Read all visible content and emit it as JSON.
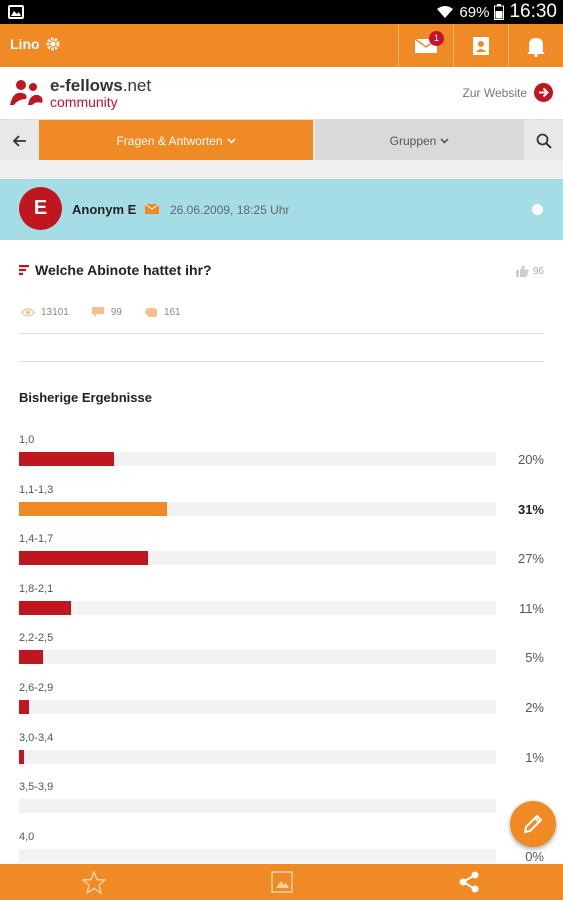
{
  "status_bar": {
    "battery": "69%",
    "time": "16:30"
  },
  "app_bar": {
    "user_name": "Lino",
    "mail_badge": "1"
  },
  "brand": {
    "logo_main": "e-fellows",
    "logo_tld": ".net",
    "logo_sub": "community",
    "website_link": "Zur Website"
  },
  "tabs": {
    "qa_label": "Fragen & Antworten",
    "groups_label": "Gruppen"
  },
  "post": {
    "avatar_letter": "E",
    "author": "Anonym E",
    "date": "26.06.2009, 18:25 Uhr",
    "question": "Welche Abinote hattet ihr?",
    "likes": "96",
    "views": "13101",
    "comments": "99",
    "votes": "161"
  },
  "results": {
    "title": "Bisherige Ergebnisse",
    "options": [
      {
        "label": "1,0",
        "percent": 20,
        "pct_text": "20%"
      },
      {
        "label": "1,1-1,3",
        "percent": 31,
        "pct_text": "31%"
      },
      {
        "label": "1,4-1,7",
        "percent": 27,
        "pct_text": "27%"
      },
      {
        "label": "1,8-2,1",
        "percent": 11,
        "pct_text": "11%"
      },
      {
        "label": "2,2-2,5",
        "percent": 5,
        "pct_text": "5%"
      },
      {
        "label": "2,6-2,9",
        "percent": 2,
        "pct_text": "2%"
      },
      {
        "label": "3,0-3,4",
        "percent": 1,
        "pct_text": "1%"
      },
      {
        "label": "3,5-3,9",
        "percent": 0,
        "pct_text": ""
      },
      {
        "label": "4,0",
        "percent": 0,
        "pct_text": "0%"
      }
    ]
  },
  "colors": {
    "brand_orange": "#f08a24",
    "brand_red": "#c0161f",
    "author_bg": "#a5dde5"
  }
}
